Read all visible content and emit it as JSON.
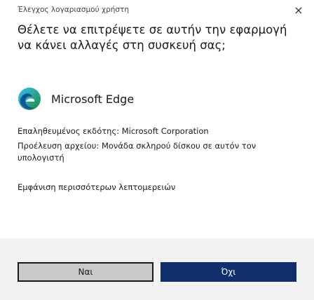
{
  "dialog": {
    "caption": "Έλεγχος λογαριασμού χρήστη",
    "question": "Θέλετε να επιτρέψετε σε αυτήν την εφαρμογή να κάνει αλλαγές στη συσκευή σας;",
    "close_icon": "×",
    "app_name": "Microsoft Edge",
    "app_icon": "microsoft-edge-icon",
    "publisher": "Επαληθευμένος εκδότης: Microsoft Corporation",
    "origin": "Προέλευση αρχείου: Μονάδα σκληρού δίσκου σε αυτόν τον υπολογιστή",
    "more_details": "Εμφάνιση περισσότερων λεπτομερειών",
    "yes_label": "Ναι",
    "no_label": "Όχι"
  }
}
